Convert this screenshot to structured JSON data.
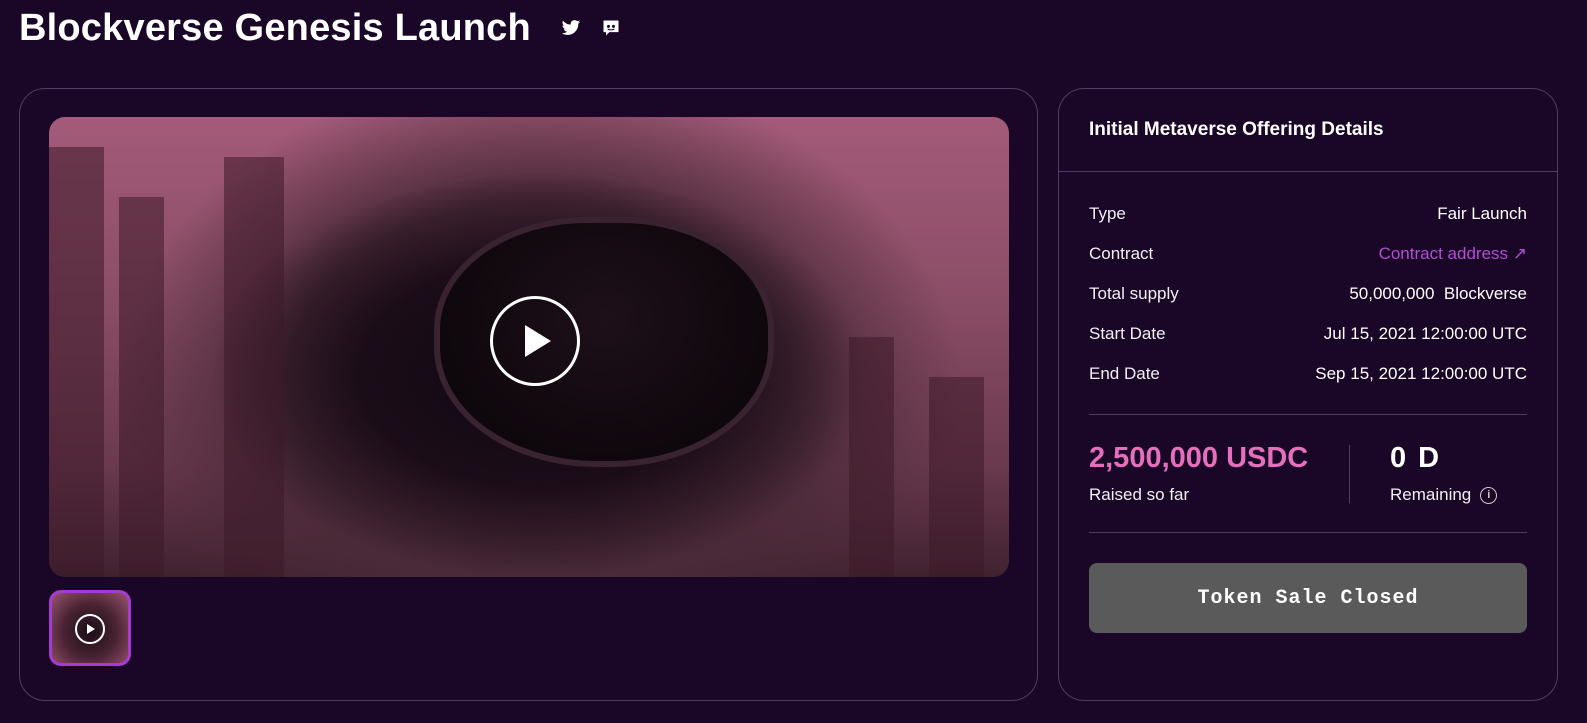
{
  "header": {
    "title": "Blockverse Genesis Launch",
    "social_icons": [
      "twitter-icon",
      "discord-icon"
    ]
  },
  "media": {
    "main_video_icon": "play-icon",
    "thumbnail_icon": "play-icon"
  },
  "offering": {
    "title": "Initial Metaverse Offering Details",
    "type_label": "Type",
    "type_value": "Fair Launch",
    "contract_label": "Contract",
    "contract_value": "Contract address ↗",
    "supply_label": "Total supply",
    "supply_amount": "50,000,000",
    "supply_token": "Blockverse",
    "start_label": "Start Date",
    "start_date": "Jul 15, 2021",
    "start_time": "12:00:00 UTC",
    "end_label": "End Date",
    "end_date": "Sep 15, 2021",
    "end_time": "12:00:00 UTC"
  },
  "stats": {
    "raised_value": "2,500,000 USDC",
    "raised_label": "Raised so far",
    "remaining_value": "0 D",
    "remaining_label": "Remaining",
    "info_icon": "info-icon"
  },
  "action": {
    "button_label": "Token Sale Closed"
  },
  "colors": {
    "background": "#1a0626",
    "accent_pink": "#e46fbc",
    "link_purple": "#b24fd6",
    "disabled_button": "#5a5a5a",
    "border": "#4f3e63"
  }
}
